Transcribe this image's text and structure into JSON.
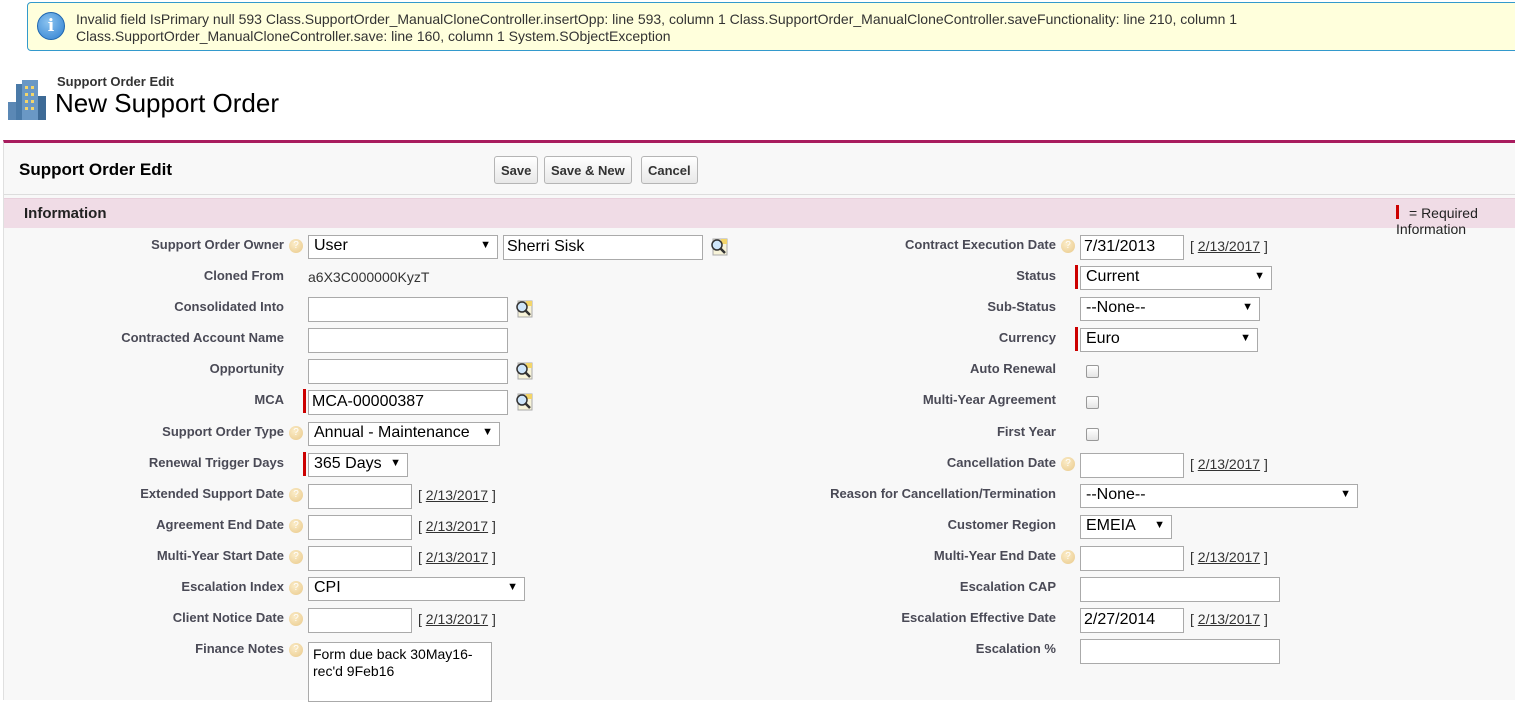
{
  "alert": {
    "icon": "info-icon",
    "message": "Invalid field IsPrimary null 593 Class.SupportOrder_ManualCloneController.insertOpp: line 593, column 1 Class.SupportOrder_ManualCloneController.saveFunctionality: line 210, column 1 Class.SupportOrder_ManualCloneController.save: line 160, column 1 System.SObjectException"
  },
  "header": {
    "type": "Support Order Edit",
    "title": "New Support Order"
  },
  "block": {
    "title": "Support Order Edit",
    "save": "Save",
    "save_new": "Save & New",
    "cancel": "Cancel"
  },
  "section": {
    "title": "Information",
    "required_legend": "= Required Information"
  },
  "today_link": "2/13/2017",
  "colors": {
    "required": "#cc0000",
    "accent": "#a81c5e",
    "section_bg": "#f0dce6"
  },
  "left": [
    {
      "label": "Support Order Owner",
      "help": true,
      "type": "owner",
      "select": "User",
      "value": "Sherri Sisk"
    },
    {
      "label": "Cloned From",
      "type": "readonly",
      "value": "a6X3C000000KyzT"
    },
    {
      "label": "Consolidated Into",
      "type": "lookup",
      "value": ""
    },
    {
      "label": "Contracted Account Name",
      "type": "text",
      "value": ""
    },
    {
      "label": "Opportunity",
      "type": "lookup",
      "value": ""
    },
    {
      "label": "MCA",
      "type": "lookup",
      "required": true,
      "value": "MCA-00000387"
    },
    {
      "label": "Support Order Type",
      "help": true,
      "type": "select",
      "value": "Annual - Maintenance"
    },
    {
      "label": "Renewal Trigger Days",
      "type": "select",
      "required": true,
      "value": "365 Days"
    },
    {
      "label": "Extended Support Date",
      "help": true,
      "type": "date",
      "value": ""
    },
    {
      "label": "Agreement End Date",
      "help": true,
      "type": "date",
      "value": ""
    },
    {
      "label": "Multi-Year Start Date",
      "help": true,
      "type": "date",
      "value": ""
    },
    {
      "label": "Escalation Index",
      "help": true,
      "type": "select",
      "value": "CPI"
    },
    {
      "label": "Client Notice Date",
      "help": true,
      "type": "date",
      "value": ""
    },
    {
      "label": "Finance Notes",
      "help": true,
      "type": "textarea",
      "value": "Form due back 30May16-rec'd 9Feb16"
    }
  ],
  "right": [
    {
      "label": "Contract Execution Date",
      "help": true,
      "type": "date",
      "value": "7/31/2013"
    },
    {
      "label": "Status",
      "type": "select",
      "required": true,
      "value": "Current"
    },
    {
      "label": "Sub-Status",
      "type": "select",
      "value": "--None--"
    },
    {
      "label": "Currency",
      "type": "select",
      "required": true,
      "value": "Euro"
    },
    {
      "label": "Auto Renewal",
      "type": "checkbox",
      "checked": false
    },
    {
      "label": "Multi-Year Agreement",
      "type": "checkbox",
      "checked": false
    },
    {
      "label": "First Year",
      "type": "checkbox",
      "checked": false
    },
    {
      "label": "Cancellation Date",
      "help": true,
      "type": "date",
      "value": ""
    },
    {
      "label": "Reason for Cancellation/Termination",
      "type": "select",
      "value": "--None--"
    },
    {
      "label": "Customer Region",
      "type": "select",
      "value": "EMEIA"
    },
    {
      "label": "Multi-Year End Date",
      "help": true,
      "type": "date",
      "value": ""
    },
    {
      "label": "Escalation CAP",
      "type": "text",
      "value": ""
    },
    {
      "label": "Escalation Effective Date",
      "type": "date",
      "value": "2/27/2014"
    },
    {
      "label": "Escalation %",
      "type": "text",
      "value": ""
    }
  ]
}
